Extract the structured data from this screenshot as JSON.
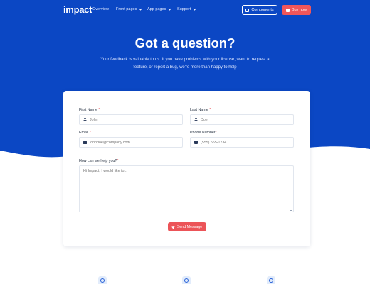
{
  "nav": {
    "logo": "impact",
    "links": [
      {
        "label": "Overview",
        "icon": null
      },
      {
        "label": "Front pages",
        "icon": "chevron-down-icon"
      },
      {
        "label": "App pages",
        "icon": "chevron-down-icon"
      },
      {
        "label": "Support",
        "icon": "chevron-down-icon"
      }
    ],
    "components_label": "Components",
    "buy_label": "Buy now"
  },
  "hero": {
    "title": "Got a question?",
    "subtitle": "Your feedback is valuable to us. If you have problems with your license, want to request a feature, or report a bug, we're more than happy to help"
  },
  "form": {
    "first_name": {
      "label": "First Name",
      "required_mark": "*",
      "placeholder": "John",
      "icon": "user-icon"
    },
    "last_name": {
      "label": "Last Name",
      "required_mark": "*",
      "placeholder": "Doe",
      "icon": "user-icon"
    },
    "email": {
      "label": "Email",
      "required_mark": "*",
      "placeholder": "johndoe@company.com",
      "icon": "envelope-icon"
    },
    "phone": {
      "label": "Phone Number",
      "required_mark": "*",
      "placeholder": "(555) 555-1234",
      "icon": "phone-icon"
    },
    "message": {
      "label": "How can we help you?",
      "required_mark": "*",
      "placeholder": "Hi Impact, I would like to..."
    },
    "send_label": "Send Message"
  },
  "colors": {
    "hero_blue": "#0b47c4",
    "accent_red": "#ec5458",
    "text_dark": "#2a3545"
  }
}
